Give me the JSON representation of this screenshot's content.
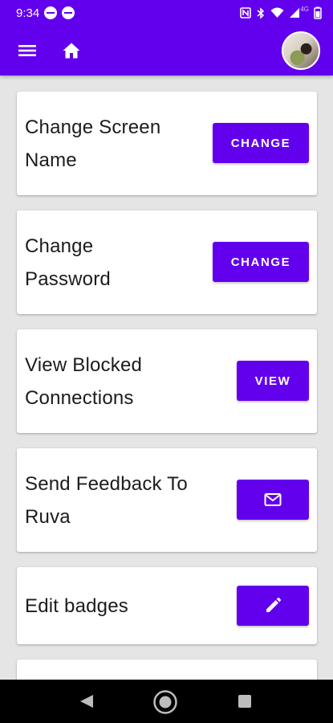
{
  "status_bar": {
    "time": "9:34",
    "network_label": "4G",
    "icons": [
      "notification-circle-icon",
      "notification-circle-icon",
      "nfc-icon",
      "bluetooth-icon",
      "wifi-icon",
      "signal-icon",
      "battery-icon"
    ]
  },
  "app_bar": {
    "menu_icon": "menu-icon",
    "home_icon": "home-icon",
    "avatar_icon": "user-avatar"
  },
  "cards": [
    {
      "title_line1": "Change Screen",
      "title_line2": "Name",
      "button_label": "CHANGE"
    },
    {
      "title_line1": "Change",
      "title_line2": "Password",
      "button_label": "CHANGE"
    },
    {
      "title_line1": "View Blocked",
      "title_line2": "Connections",
      "button_label": "VIEW"
    },
    {
      "title_line1": "Send Feedback To",
      "title_line2": "Ruva",
      "button_icon": "mail-icon"
    },
    {
      "title": "Edit badges",
      "button_icon": "pencil-icon"
    }
  ],
  "colors": {
    "primary": "#6200ee",
    "background": "#e5e5e5",
    "card": "#ffffff",
    "text": "#1c1c1c"
  }
}
